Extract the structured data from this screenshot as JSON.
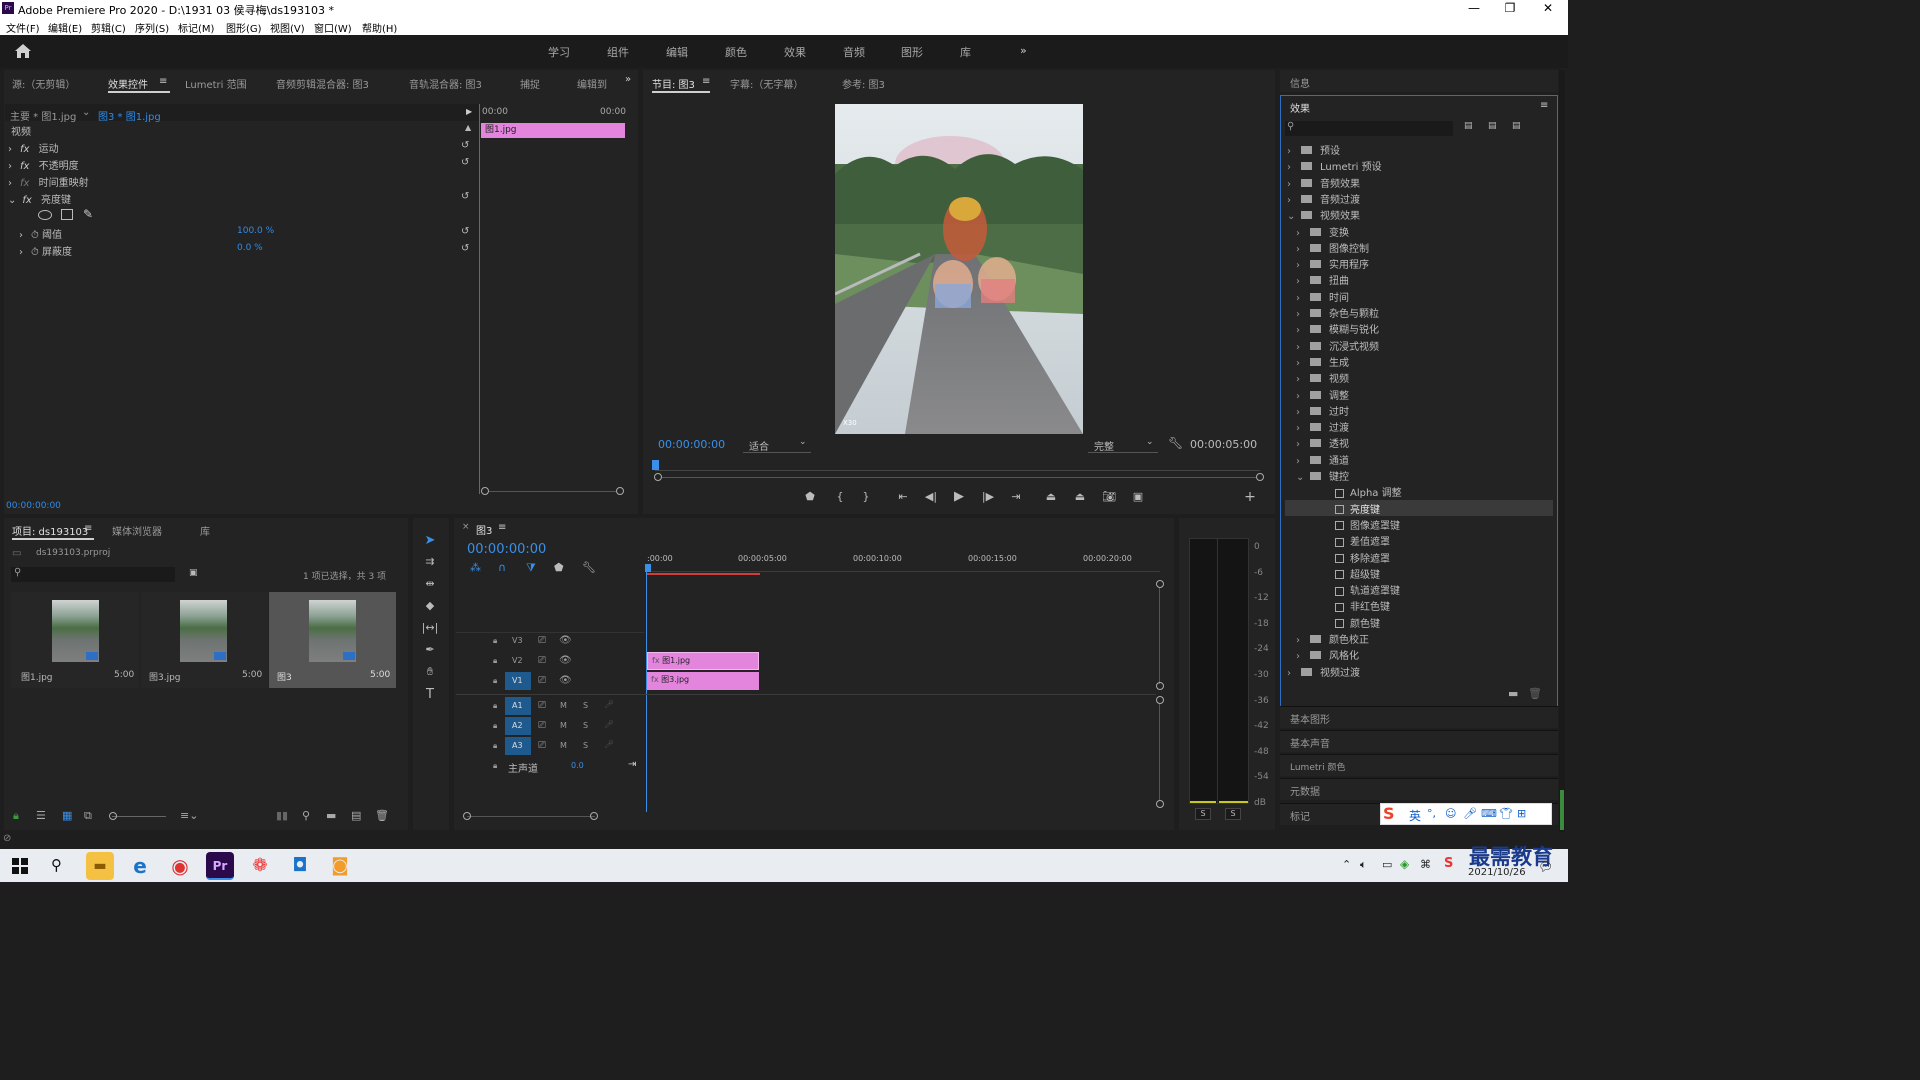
{
  "window": {
    "title": "Adobe Premiere Pro 2020 - D:\\1931 03 侯寻梅\\ds193103 *"
  },
  "menu": [
    "文件(F)",
    "编辑(E)",
    "剪辑(C)",
    "序列(S)",
    "标记(M)",
    "图形(G)",
    "视图(V)",
    "窗口(W)",
    "帮助(H)"
  ],
  "workspaces": [
    "学习",
    "组件",
    "编辑",
    "颜色",
    "效果",
    "音频",
    "图形",
    "库"
  ],
  "source_panel": {
    "tabs": [
      "源:（无剪辑）",
      "效果控件",
      "Lumetri 范围",
      "音频剪辑混合器: 图3",
      "音轨混合器: 图3",
      "捕捉",
      "编辑到"
    ],
    "master_label": "主要 * 图1.jpg",
    "sequence_label": "图3 * 图1.jpg",
    "section_video": "视频",
    "fx_motion": "运动",
    "fx_opacity": "不透明度",
    "fx_timeremap": "时间重映射",
    "fx_lumakey": "亮度键",
    "param_threshold": "阈值",
    "param_threshold_val": "100.0 %",
    "param_cutoff": "屏蔽度",
    "param_cutoff_val": "0.0 %",
    "mini_tc_left": "00:00",
    "mini_tc_right": "00:00",
    "mini_clip": "图1.jpg",
    "timecode": "00:00:00:00"
  },
  "program_panel": {
    "tabs": [
      "节目: 图3",
      "字幕:（无字幕）",
      "参考: 图3"
    ],
    "timecode": "00:00:00:00",
    "fit": "适合",
    "quality": "完整",
    "duration": "00:00:05:00",
    "watermark": "X30"
  },
  "right_panel": {
    "info": "信息",
    "effects_title": "效果",
    "tree": [
      {
        "label": "预设",
        "level": 0,
        "open": false
      },
      {
        "label": "Lumetri 预设",
        "level": 0,
        "open": false
      },
      {
        "label": "音频效果",
        "level": 0,
        "open": false
      },
      {
        "label": "音频过渡",
        "level": 0,
        "open": false
      },
      {
        "label": "视频效果",
        "level": 0,
        "open": true
      },
      {
        "label": "变换",
        "level": 1,
        "open": false
      },
      {
        "label": "图像控制",
        "level": 1,
        "open": false
      },
      {
        "label": "实用程序",
        "level": 1,
        "open": false
      },
      {
        "label": "扭曲",
        "level": 1,
        "open": false
      },
      {
        "label": "时间",
        "level": 1,
        "open": false
      },
      {
        "label": "杂色与颗粒",
        "level": 1,
        "open": false
      },
      {
        "label": "模糊与锐化",
        "level": 1,
        "open": false
      },
      {
        "label": "沉浸式视频",
        "level": 1,
        "open": false
      },
      {
        "label": "生成",
        "level": 1,
        "open": false
      },
      {
        "label": "视频",
        "level": 1,
        "open": false
      },
      {
        "label": "调整",
        "level": 1,
        "open": false
      },
      {
        "label": "过时",
        "level": 1,
        "open": false
      },
      {
        "label": "过渡",
        "level": 1,
        "open": false
      },
      {
        "label": "透视",
        "level": 1,
        "open": false
      },
      {
        "label": "通道",
        "level": 1,
        "open": false
      },
      {
        "label": "键控",
        "level": 1,
        "open": true
      },
      {
        "label": "Alpha 调整",
        "level": 2,
        "open": false
      },
      {
        "label": "亮度键",
        "level": 2,
        "open": false,
        "selected": true
      },
      {
        "label": "图像遮罩键",
        "level": 2,
        "open": false
      },
      {
        "label": "差值遮罩",
        "level": 2,
        "open": false
      },
      {
        "label": "移除遮罩",
        "level": 2,
        "open": false
      },
      {
        "label": "超级键",
        "level": 2,
        "open": false
      },
      {
        "label": "轨道遮罩键",
        "level": 2,
        "open": false
      },
      {
        "label": "非红色键",
        "level": 2,
        "open": false
      },
      {
        "label": "颜色键",
        "level": 2,
        "open": false
      },
      {
        "label": "颜色校正",
        "level": 1,
        "open": false
      },
      {
        "label": "风格化",
        "level": 1,
        "open": false
      },
      {
        "label": "视频过渡",
        "level": 0,
        "open": false
      }
    ],
    "sections": [
      "基本图形",
      "基本声音",
      "Lumetri 颜色",
      "元数据",
      "标记"
    ]
  },
  "project_panel": {
    "tabs": [
      "项目: ds193103",
      "媒体浏览器",
      "库"
    ],
    "file": "ds193103.prproj",
    "selection": "1 项已选择，共 3 项",
    "items": [
      {
        "name": "图1.jpg",
        "dur": "5:00"
      },
      {
        "name": "图3.jpg",
        "dur": "5:00"
      },
      {
        "name": "图3",
        "dur": "5:00"
      }
    ]
  },
  "timeline": {
    "tab": "图3",
    "timecode": "00:00:00:00",
    "ruler": [
      ":00:00",
      "00:00:05:00",
      "00:00:10:00",
      "00:00:15:00",
      "00:00:20:00"
    ],
    "video_tracks": [
      "V3",
      "V2",
      "V1"
    ],
    "audio_tracks": [
      "A1",
      "A2",
      "A3"
    ],
    "master": "主声道",
    "master_val": "0.0",
    "clip_v2": "图1.jpg",
    "clip_v1": "图3.jpg"
  },
  "meter": {
    "scale": [
      "0",
      "-6",
      "-12",
      "-18",
      "-24",
      "-30",
      "-36",
      "-42",
      "-48",
      "-54",
      "dB"
    ],
    "solo": [
      "S",
      "S"
    ]
  },
  "ime": {
    "lang": "英"
  },
  "taskbar": {
    "date": "2021/10/26",
    "brand": "最需教育"
  }
}
